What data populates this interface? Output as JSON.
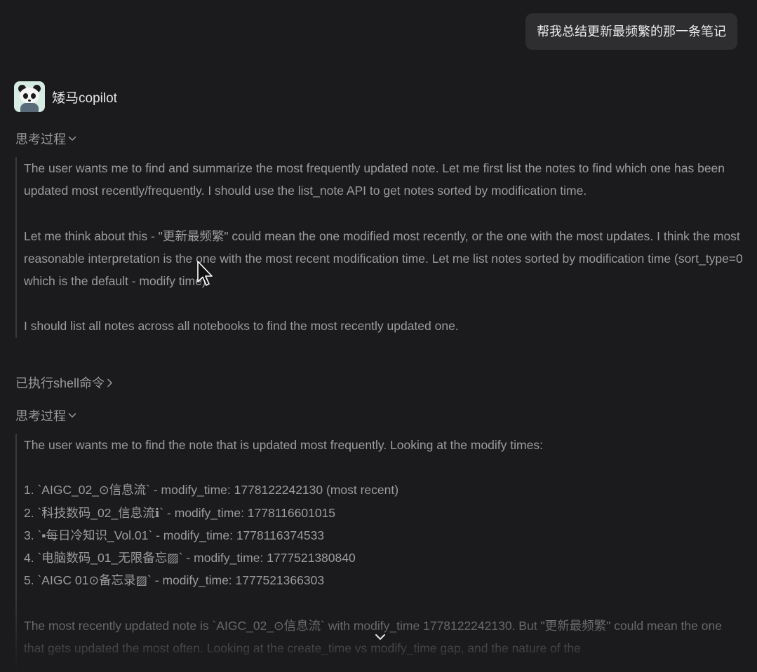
{
  "user_message": "帮我总结更新最频繁的那一条笔记",
  "assistant": {
    "name": "矮马copilot",
    "avatar_icon": "panda-icon"
  },
  "thinking_1": {
    "label": "思考过程",
    "para_1": "The user wants me to find and summarize the most frequently updated note. Let me first list the notes to find which one has been updated most recently/frequently. I should use the list_note API to get notes sorted by modification time.",
    "para_2": "Let me think about this - \"更新最频繁\" could mean the one modified most recently, or the one with the most updates. I think the most reasonable interpretation is the one with the most recent modification time. Let me list notes sorted by modification time (sort_type=0 which is the default - modify time).",
    "para_3": "I should list all notes across all notebooks to find the most recently updated one."
  },
  "shell_step": {
    "label": "已执行shell命令"
  },
  "thinking_2": {
    "label": "思考过程",
    "intro": "The user wants me to find the note that is updated most frequently. Looking at the modify times:",
    "items": [
      "1. `AIGC_02_⊙信息流` - modify_time: 1778122242130 (most recent)",
      "2. `科技数码_02_信息流ℹ` - modify_time: 1778116601015",
      "3. `▪每日冷知识_Vol.01` - modify_time: 1778116374533",
      "4. `电脑数码_01_无限备忘▨` - modify_time: 1777521380840",
      "5. `AIGC 01⊙备忘录▨` - modify_time: 1777521366303"
    ],
    "outro": "The most recently updated note is `AIGC_02_⊙信息流` with modify_time 1778122242130. But \"更新最频繁\" could mean the one that gets updated the most often. Looking at the create_time vs modify_time gap, and the nature of the"
  },
  "scroll_button_icon": "chevron-down-icon",
  "cursor_icon": "mouse-pointer-icon",
  "colors": {
    "background": "#1b1b1d",
    "bubble": "#2e2e31",
    "text_muted": "#9c9c9e",
    "text_bright": "#e5e5e7"
  }
}
